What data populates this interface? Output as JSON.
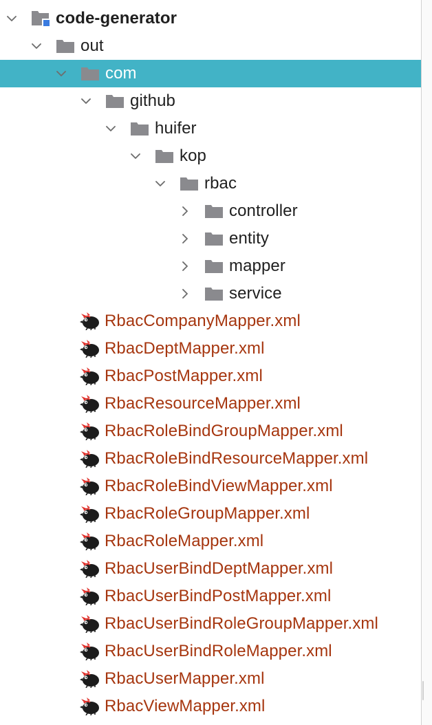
{
  "project_tree": {
    "nodes": [
      {
        "id": "code-generator",
        "label": "code-generator",
        "kind": "module",
        "depth": 0,
        "expanded": true,
        "selected": false
      },
      {
        "id": "out",
        "label": "out",
        "kind": "folder",
        "depth": 1,
        "expanded": true,
        "selected": false
      },
      {
        "id": "com",
        "label": "com",
        "kind": "folder",
        "depth": 2,
        "expanded": true,
        "selected": true
      },
      {
        "id": "github",
        "label": "github",
        "kind": "folder",
        "depth": 3,
        "expanded": true,
        "selected": false
      },
      {
        "id": "huifer",
        "label": "huifer",
        "kind": "folder",
        "depth": 4,
        "expanded": true,
        "selected": false
      },
      {
        "id": "kop",
        "label": "kop",
        "kind": "folder",
        "depth": 5,
        "expanded": true,
        "selected": false
      },
      {
        "id": "rbac",
        "label": "rbac",
        "kind": "folder",
        "depth": 6,
        "expanded": true,
        "selected": false
      },
      {
        "id": "controller",
        "label": "controller",
        "kind": "folder",
        "depth": 7,
        "expanded": false,
        "selected": false
      },
      {
        "id": "entity",
        "label": "entity",
        "kind": "folder",
        "depth": 7,
        "expanded": false,
        "selected": false
      },
      {
        "id": "mapper",
        "label": "mapper",
        "kind": "folder",
        "depth": 7,
        "expanded": false,
        "selected": false
      },
      {
        "id": "service",
        "label": "service",
        "kind": "folder",
        "depth": 7,
        "expanded": false,
        "selected": false
      },
      {
        "id": "f1",
        "label": "RbacCompanyMapper.xml",
        "kind": "mybatis-xml",
        "depth": 2
      },
      {
        "id": "f2",
        "label": "RbacDeptMapper.xml",
        "kind": "mybatis-xml",
        "depth": 2
      },
      {
        "id": "f3",
        "label": "RbacPostMapper.xml",
        "kind": "mybatis-xml",
        "depth": 2
      },
      {
        "id": "f4",
        "label": "RbacResourceMapper.xml",
        "kind": "mybatis-xml",
        "depth": 2
      },
      {
        "id": "f5",
        "label": "RbacRoleBindGroupMapper.xml",
        "kind": "mybatis-xml",
        "depth": 2
      },
      {
        "id": "f6",
        "label": "RbacRoleBindResourceMapper.xml",
        "kind": "mybatis-xml",
        "depth": 2
      },
      {
        "id": "f7",
        "label": "RbacRoleBindViewMapper.xml",
        "kind": "mybatis-xml",
        "depth": 2
      },
      {
        "id": "f8",
        "label": "RbacRoleGroupMapper.xml",
        "kind": "mybatis-xml",
        "depth": 2
      },
      {
        "id": "f9",
        "label": "RbacRoleMapper.xml",
        "kind": "mybatis-xml",
        "depth": 2
      },
      {
        "id": "f10",
        "label": "RbacUserBindDeptMapper.xml",
        "kind": "mybatis-xml",
        "depth": 2
      },
      {
        "id": "f11",
        "label": "RbacUserBindPostMapper.xml",
        "kind": "mybatis-xml",
        "depth": 2
      },
      {
        "id": "f12",
        "label": "RbacUserBindRoleGroupMapper.xml",
        "kind": "mybatis-xml",
        "depth": 2
      },
      {
        "id": "f13",
        "label": "RbacUserBindRoleMapper.xml",
        "kind": "mybatis-xml",
        "depth": 2
      },
      {
        "id": "f14",
        "label": "RbacUserMapper.xml",
        "kind": "mybatis-xml",
        "depth": 2
      },
      {
        "id": "f15",
        "label": "RbacViewMapper.xml",
        "kind": "mybatis-xml",
        "depth": 2
      }
    ]
  },
  "colors": {
    "selection": "#42b3c6",
    "folder": "#8a8a8e",
    "module_badge": "#3a7be0",
    "file_text": "#a6360f",
    "text": "#1f1f1f",
    "chevron": "#6e6e6e"
  },
  "icons": {
    "module": "module-folder-icon",
    "folder": "folder-icon",
    "mybatis-xml": "mybatis-bird-icon",
    "expanded": "chevron-down-icon",
    "collapsed": "chevron-right-icon"
  }
}
